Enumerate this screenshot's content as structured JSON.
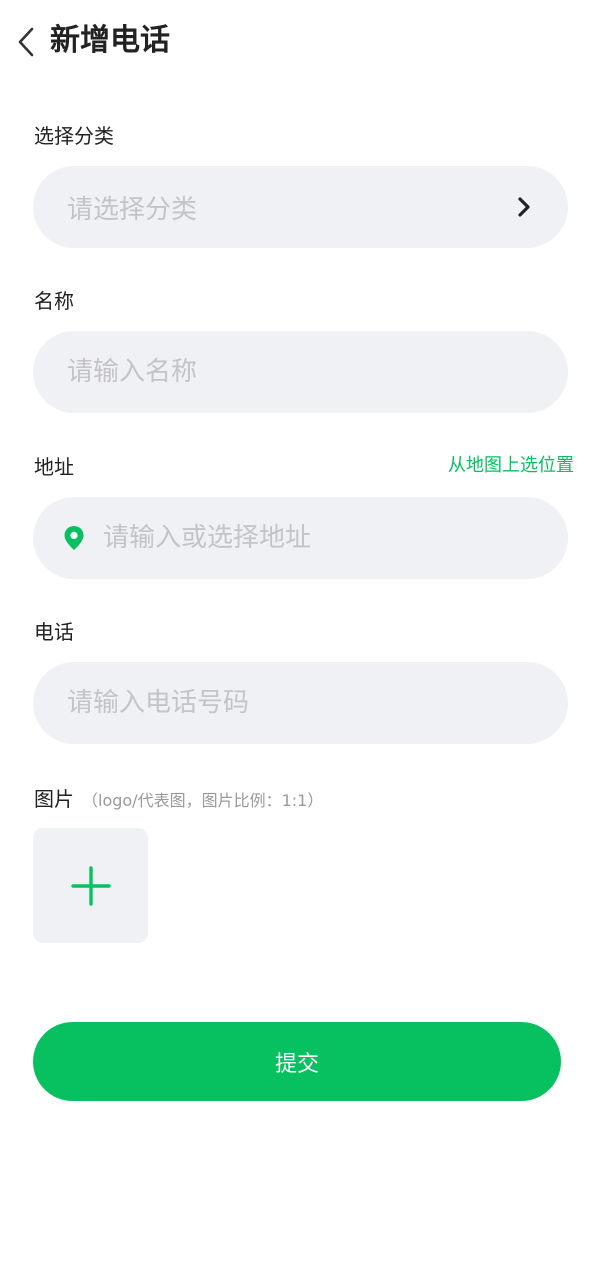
{
  "header": {
    "title": "新增电话"
  },
  "form": {
    "category": {
      "label": "选择分类",
      "placeholder": "请选择分类"
    },
    "name": {
      "label": "名称",
      "placeholder": "请输入名称",
      "value": ""
    },
    "address": {
      "label": "地址",
      "map_link": "从地图上选位置",
      "placeholder": "请输入或选择地址",
      "value": ""
    },
    "phone": {
      "label": "电话",
      "placeholder": "请输入电话号码",
      "value": ""
    },
    "image": {
      "label": "图片",
      "hint": "（logo/代表图，图片比例：1:1）"
    },
    "submit_label": "提交"
  },
  "colors": {
    "accent": "#07c160",
    "input_bg": "#f0f1f5",
    "placeholder": "#c4c4c8"
  },
  "icons": {
    "back": "chevron-left-icon",
    "select_arrow": "chevron-right-icon",
    "location": "location-pin-icon",
    "add_image": "plus-icon"
  }
}
